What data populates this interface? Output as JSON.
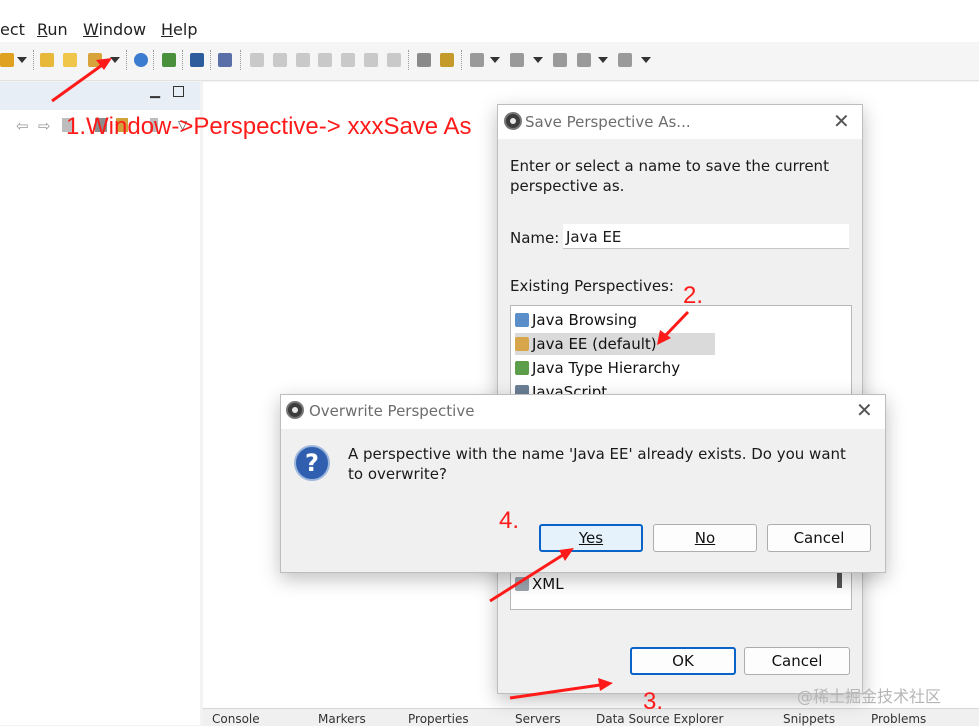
{
  "menubar": {
    "items": [
      {
        "label": "ect"
      },
      {
        "label": "Run",
        "mnemonic": "R",
        "rest": "un"
      },
      {
        "label": "Window",
        "mnemonic": "W",
        "rest": "indow"
      },
      {
        "label": "Help",
        "mnemonic": "H",
        "rest": "elp"
      }
    ]
  },
  "toolbar": {
    "icons": [
      "new-wizard-icon",
      "open-folder-icon",
      "open-folder-icon",
      "run-icon",
      "globe-icon",
      "debug-icon",
      "console-icon",
      "pin-icon",
      "resume-icon",
      "suspend-icon",
      "terminate-icon",
      "disconnect-icon",
      "step-into-icon",
      "step-over-icon",
      "step-return-icon",
      "task-icon",
      "search-icon",
      "next-annotation-icon",
      "prev-annotation-icon",
      "last-edit-icon",
      "back-icon",
      "forward-icon"
    ]
  },
  "annotations": {
    "step1": "1.Window->Perspective-> xxxSave As",
    "step2": "2.",
    "step3": "3.",
    "step4": "4.",
    "color": "#ff1a1a"
  },
  "save_dialog": {
    "title": "Save Perspective As...",
    "description": "Enter or select a name to save the current perspective as.",
    "name_label": "Name:",
    "name_value": "Java EE",
    "existing_label": "Existing Perspectives:",
    "perspectives": [
      {
        "label": "Java Browsing",
        "icon": "java-browsing-icon"
      },
      {
        "label": "Java EE (default)",
        "icon": "java-ee-icon",
        "selected": true
      },
      {
        "label": "Java Type Hierarchy",
        "icon": "type-hierarchy-icon"
      },
      {
        "label": "JavaScript",
        "icon": "javascript-icon"
      },
      {
        "label": "XML",
        "icon": "xml-icon"
      }
    ],
    "ok_label": "OK",
    "cancel_label": "Cancel"
  },
  "overwrite_dialog": {
    "title": "Overwrite Perspective",
    "message": "A perspective with the name 'Java EE' already exists. Do you want to overwrite?",
    "yes_label": "Yes",
    "no_label": "No",
    "cancel_label": "Cancel"
  },
  "bottom_tabs": [
    "Console",
    "Markers",
    "Properties",
    "Servers",
    "Data Source Explorer",
    "Snippets",
    "Problems"
  ],
  "watermark": "@稀土掘金技术社区",
  "colors": {
    "accent": "#0a64c8",
    "selection": "#dadada",
    "info_icon": "#2f5fae"
  }
}
